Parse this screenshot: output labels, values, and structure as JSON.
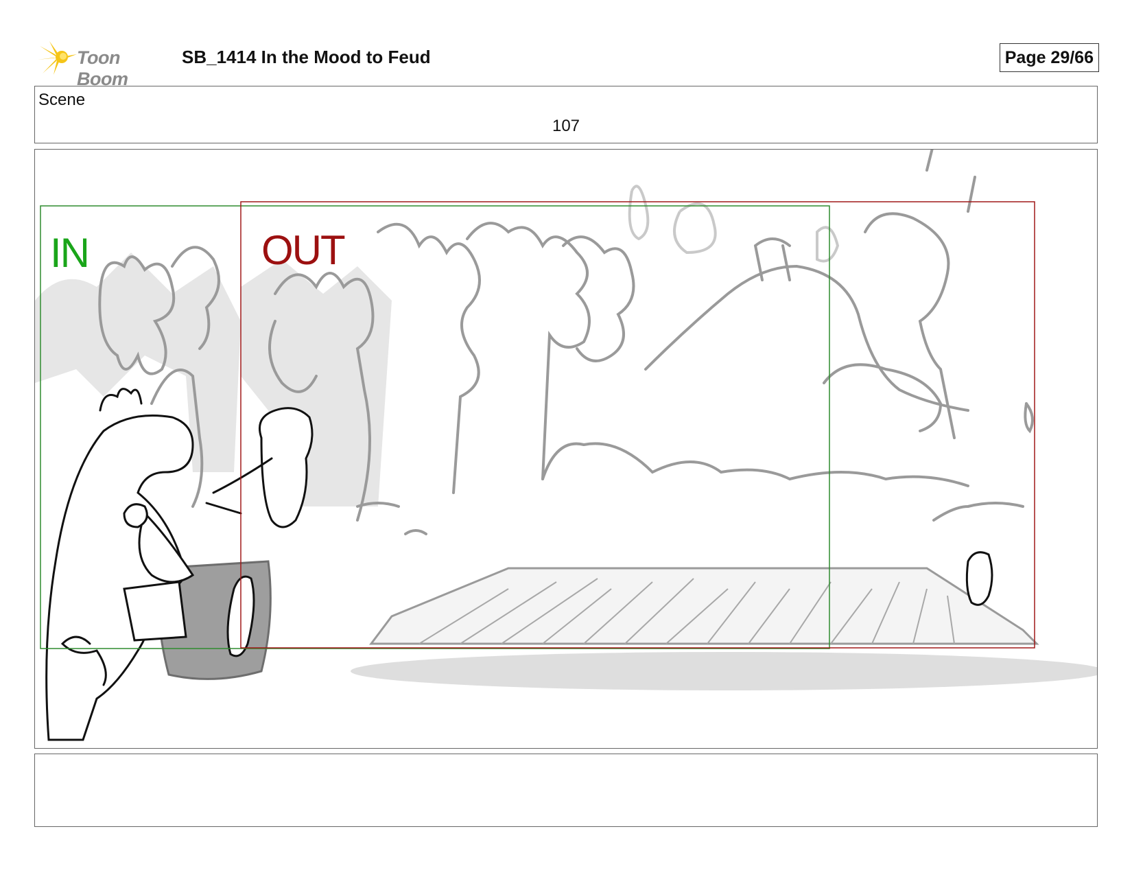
{
  "header": {
    "logo_name": "Toon Boom",
    "title": "SB_1414  In the Mood to Feud",
    "page": "Page 29/66"
  },
  "scene": {
    "label": "Scene",
    "number": "107"
  },
  "panel": {
    "in_label": "IN",
    "out_label": "OUT",
    "colors": {
      "in_frame": "#2e8b2e",
      "out_frame": "#a01818",
      "sketch": "#9a9a9a",
      "ink": "#111111"
    }
  },
  "caption": {
    "text": ""
  }
}
